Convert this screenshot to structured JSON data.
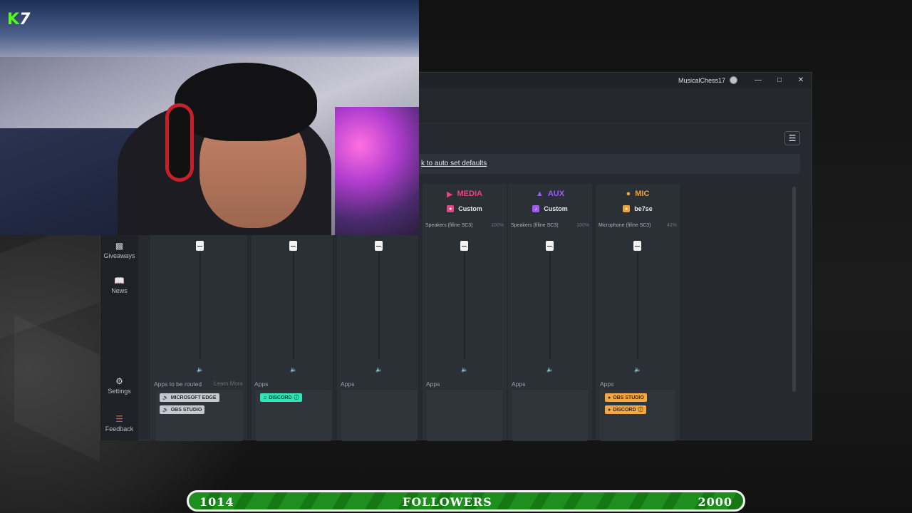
{
  "window": {
    "username": "MusicalChess17",
    "minimize_icon": "minimize-icon",
    "maximize_icon": "maximize-icon",
    "close_icon": "close-icon"
  },
  "banner": {
    "visible_text": "k to auto set defaults"
  },
  "sidebar": {
    "items": [
      {
        "label": "Giveaways",
        "icon": "gift-icon"
      },
      {
        "label": "News",
        "icon": "book-icon"
      },
      {
        "label": "Settings",
        "icon": "gear-icon"
      },
      {
        "label": "Feedback",
        "icon": "feedback-icon"
      }
    ]
  },
  "channels": [
    {
      "apps_label": "Apps to be routed",
      "learn_more": "Learn More",
      "apps": [
        "MICROSOFT EDGE",
        "OBS STUDIO"
      ]
    },
    {
      "apps_label": "Apps",
      "apps": [
        "DISCORD"
      ]
    },
    {
      "apps_label": "Apps",
      "apps": []
    },
    {
      "name": "MEDIA",
      "color": "#e8457e",
      "preset": "Custom",
      "device": "Speakers (fifine SC3)",
      "device_level": "100%",
      "apps_label": "Apps",
      "apps": []
    },
    {
      "name": "AUX",
      "color": "#9b5cf5",
      "preset": "Custom",
      "device": "Speakers (fifine SC3)",
      "device_level": "100%",
      "apps_label": "Apps",
      "apps": []
    },
    {
      "name": "MIC",
      "color": "#f0a33a",
      "preset": "be7se",
      "device": "Microphone (fifine SC3)",
      "device_level": "42%",
      "apps_label": "Apps",
      "apps": [
        "OBS STUDIO",
        "DISCORD"
      ]
    }
  ],
  "overlay": {
    "kick_logo_text": "K",
    "kick_number": "7",
    "followers_current": "1014",
    "followers_label": "FOLLOWERS",
    "followers_goal": "2000",
    "followers_progress": 0.507
  },
  "colors": {
    "window_bg": "#262a30",
    "accent_media": "#e8457e",
    "accent_aux": "#9b5cf5",
    "accent_mic": "#f0a33a",
    "discord_teal": "#2ee6b8",
    "followers_green": "#1e8f1e"
  }
}
